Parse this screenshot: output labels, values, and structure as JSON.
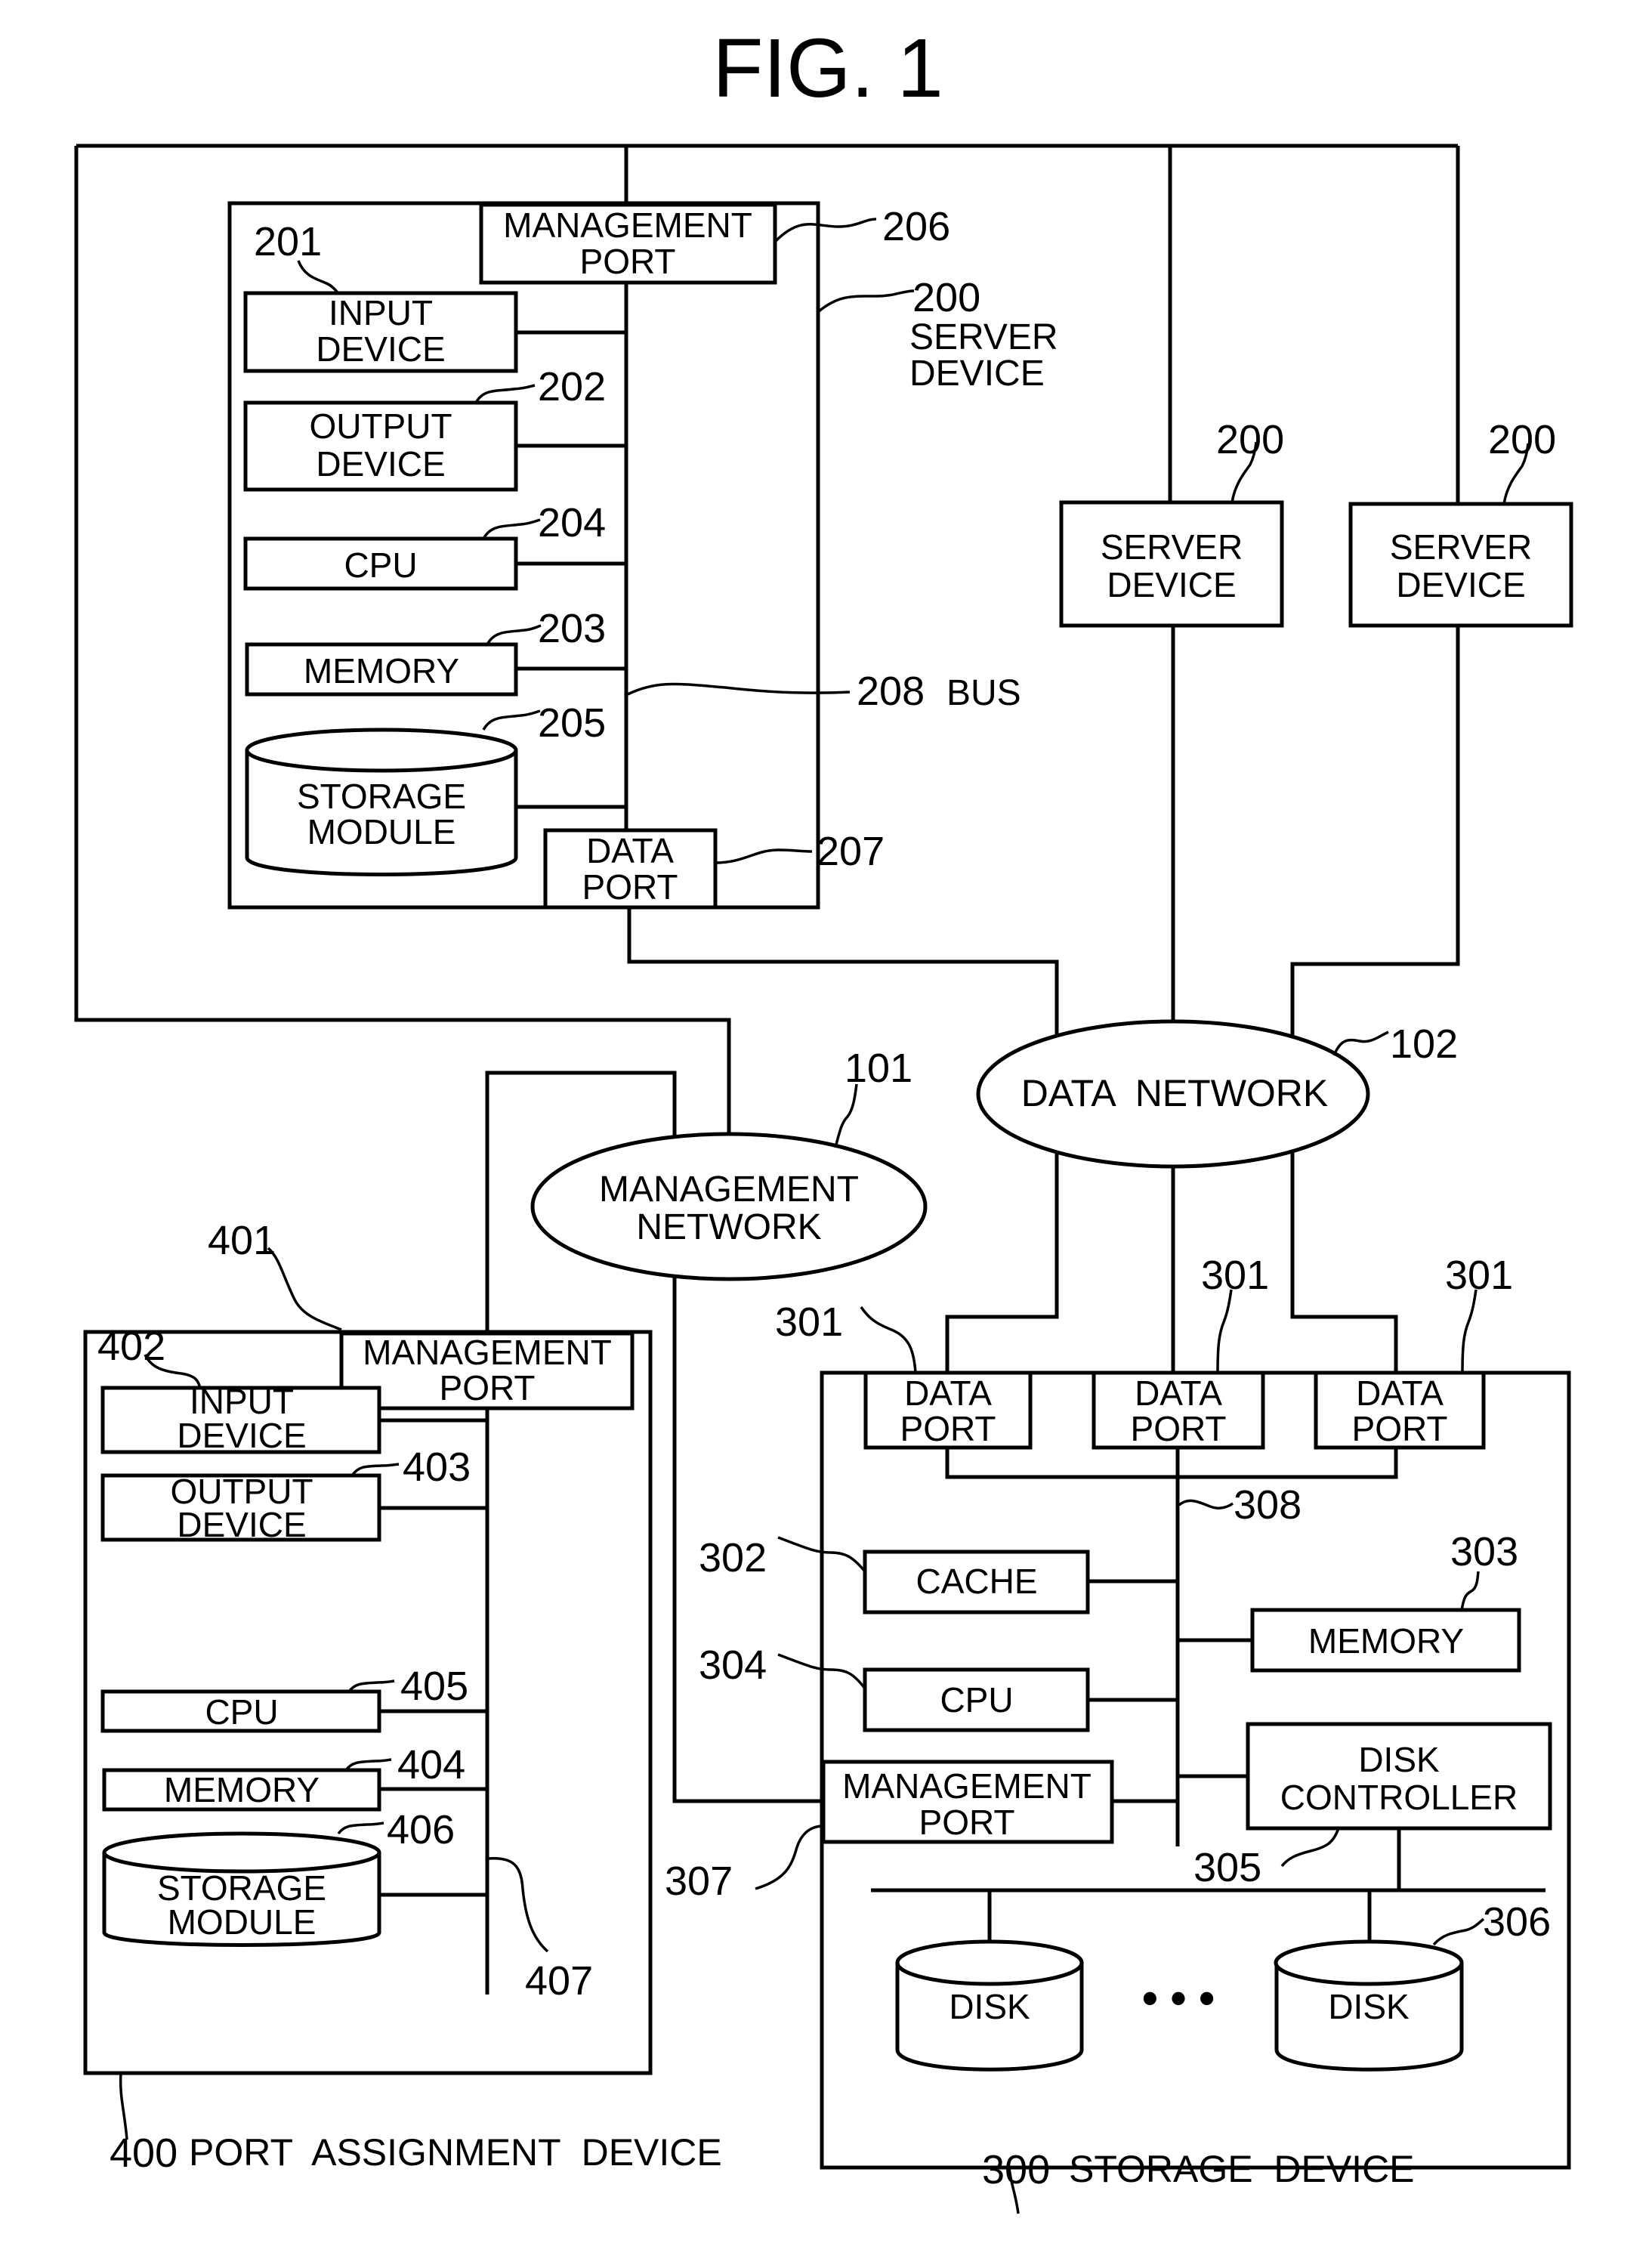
{
  "figure": {
    "title": "FIG. 1"
  },
  "server_device_detail": {
    "ref": "200",
    "name_line1": "SERVER",
    "name_line2": "DEVICE",
    "management_port": {
      "ref": "206",
      "line1": "MANAGEMENT",
      "line2": "PORT"
    },
    "input_device": {
      "ref": "201",
      "line1": "INPUT",
      "line2": "DEVICE"
    },
    "output_device": {
      "ref": "202",
      "line1": "OUTPUT",
      "line2": "DEVICE"
    },
    "cpu": {
      "ref": "204",
      "label": "CPU"
    },
    "memory": {
      "ref": "203",
      "label": "MEMORY"
    },
    "storage_module": {
      "ref": "205",
      "line1": "STORAGE",
      "line2": "MODULE"
    },
    "data_port": {
      "ref": "207",
      "line1": "DATA",
      "line2": "PORT"
    },
    "bus": {
      "ref": "208",
      "label": "BUS"
    }
  },
  "other_servers": [
    {
      "ref": "200",
      "line1": "SERVER",
      "line2": "DEVICE"
    },
    {
      "ref": "200",
      "line1": "SERVER",
      "line2": "DEVICE"
    }
  ],
  "networks": {
    "management": {
      "ref": "101",
      "line1": "MANAGEMENT",
      "line2": "NETWORK"
    },
    "data": {
      "ref": "102",
      "label": "DATA  NETWORK"
    }
  },
  "port_assignment_device": {
    "ref": "400",
    "caption": "PORT  ASSIGNMENT  DEVICE",
    "management_port": {
      "ref": "401",
      "line1": "MANAGEMENT",
      "line2": "PORT"
    },
    "input_device": {
      "ref": "402",
      "line1": "INPUT",
      "line2": "DEVICE"
    },
    "output_device": {
      "ref": "403",
      "line1": "OUTPUT",
      "line2": "DEVICE"
    },
    "cpu": {
      "ref": "405",
      "label": "CPU"
    },
    "memory": {
      "ref": "404",
      "label": "MEMORY"
    },
    "storage_module": {
      "ref": "406",
      "line1": "STORAGE",
      "line2": "MODULE"
    },
    "bus": {
      "ref": "407"
    }
  },
  "storage_device": {
    "ref": "300",
    "caption": "STORAGE  DEVICE",
    "data_ports": [
      {
        "ref": "301",
        "line1": "DATA",
        "line2": "PORT"
      },
      {
        "ref": "301",
        "line1": "DATA",
        "line2": "PORT"
      },
      {
        "ref": "301",
        "line1": "DATA",
        "line2": "PORT"
      }
    ],
    "cache": {
      "ref": "302",
      "label": "CACHE"
    },
    "memory": {
      "ref": "303",
      "label": "MEMORY"
    },
    "cpu": {
      "ref": "304",
      "label": "CPU"
    },
    "disk_controller": {
      "ref": "305",
      "line1": "DISK",
      "line2": "CONTROLLER"
    },
    "disks": [
      {
        "ref": "",
        "label": "DISK"
      },
      {
        "ref": "306",
        "label": "DISK"
      }
    ],
    "ellipsis": "• • •",
    "management_port": {
      "ref": "307",
      "line1": "MANAGEMENT",
      "line2": "PORT"
    },
    "bus": {
      "ref": "308"
    }
  }
}
